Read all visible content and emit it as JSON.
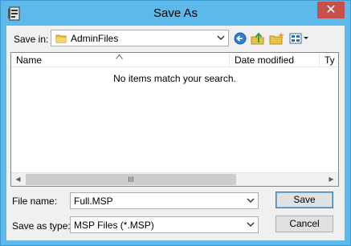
{
  "window": {
    "title": "Save As",
    "close_glyph": "✕"
  },
  "save_in": {
    "label": "Save in:",
    "value": "AdminFiles"
  },
  "toolbar": {
    "back_icon": "back-icon",
    "up_icon": "up-folder-icon",
    "new_folder_icon": "new-folder-icon",
    "views_icon": "view-menu-icon"
  },
  "list": {
    "columns": [
      {
        "label": "Name"
      },
      {
        "label": "Date modified"
      },
      {
        "label": "Ty"
      }
    ],
    "empty_message": "No items match your search.",
    "scroll_left": "◀",
    "scroll_right": "▶",
    "scroll_thumb": "III"
  },
  "file_name": {
    "label": "File name:",
    "value": "Full.MSP"
  },
  "save_as_type": {
    "label": "Save as type:",
    "value": "MSP Files (*.MSP)"
  },
  "buttons": {
    "save": "Save",
    "cancel": "Cancel"
  },
  "colors": {
    "titlebar": "#5db9e9",
    "close": "#c7504c",
    "face": "#f0f0f0"
  }
}
